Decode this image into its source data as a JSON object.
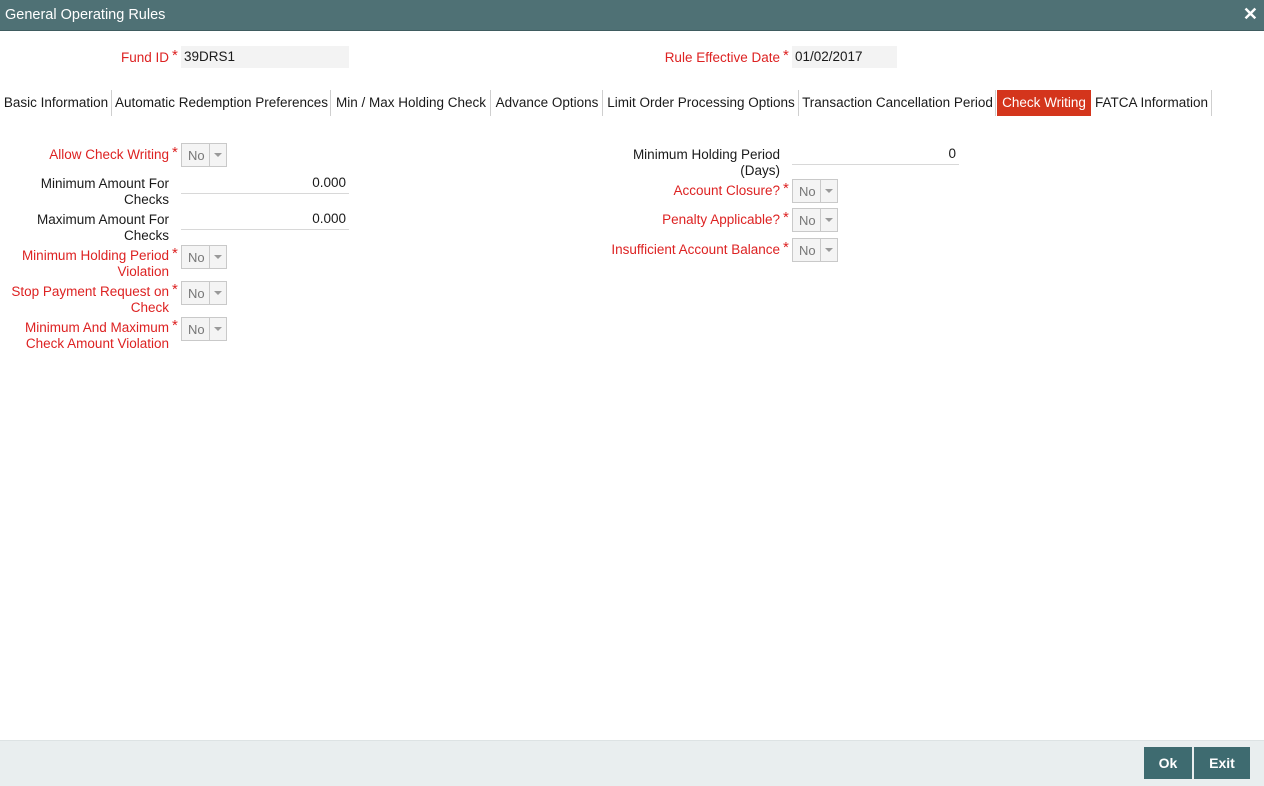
{
  "window": {
    "title": "General Operating Rules",
    "close_glyph": "✕"
  },
  "header": {
    "fund_id": {
      "label": "Fund ID",
      "value": "39DRS1"
    },
    "rule_effective_date": {
      "label": "Rule Effective Date",
      "value": "01/02/2017"
    }
  },
  "tabs": [
    {
      "label": "Basic Information"
    },
    {
      "label": "Automatic Redemption Preferences"
    },
    {
      "label": "Min / Max Holding Check"
    },
    {
      "label": "Advance Options"
    },
    {
      "label": "Limit Order Processing Options"
    },
    {
      "label": "Transaction Cancellation Period"
    },
    {
      "label": "Check Writing"
    },
    {
      "label": "FATCA Information"
    }
  ],
  "active_tab": "Check Writing",
  "left": {
    "allow_check_writing": {
      "label": "Allow Check Writing",
      "value": "No"
    },
    "min_amount": {
      "label_1": "Minimum Amount For",
      "label_2": "Checks",
      "value": "0.000"
    },
    "max_amount": {
      "label_1": "Maximum Amount For",
      "label_2": "Checks",
      "value": "0.000"
    },
    "min_holding_violation": {
      "label_1": "Minimum Holding Period",
      "label_2": "Violation",
      "value": "No"
    },
    "stop_payment": {
      "label_1": "Stop Payment Request on",
      "label_2": "Check",
      "value": "No"
    },
    "min_max_check_violation": {
      "label_1": "Minimum And Maximum",
      "label_2": "Check Amount Violation",
      "value": "No"
    }
  },
  "right": {
    "min_holding_days": {
      "label_1": "Minimum Holding Period",
      "label_2": "(Days)",
      "value": "0"
    },
    "account_closure": {
      "label": "Account Closure?",
      "value": "No"
    },
    "penalty_applicable": {
      "label": "Penalty Applicable?",
      "value": "No"
    },
    "insufficient_balance": {
      "label": "Insufficient Account Balance",
      "value": "No"
    }
  },
  "footer": {
    "ok_label": "Ok",
    "exit_label": "Exit"
  },
  "colors": {
    "titlebar": "#4f7175",
    "active_tab": "#d4351c",
    "required": "#dd2222",
    "button": "#3e6b70"
  }
}
